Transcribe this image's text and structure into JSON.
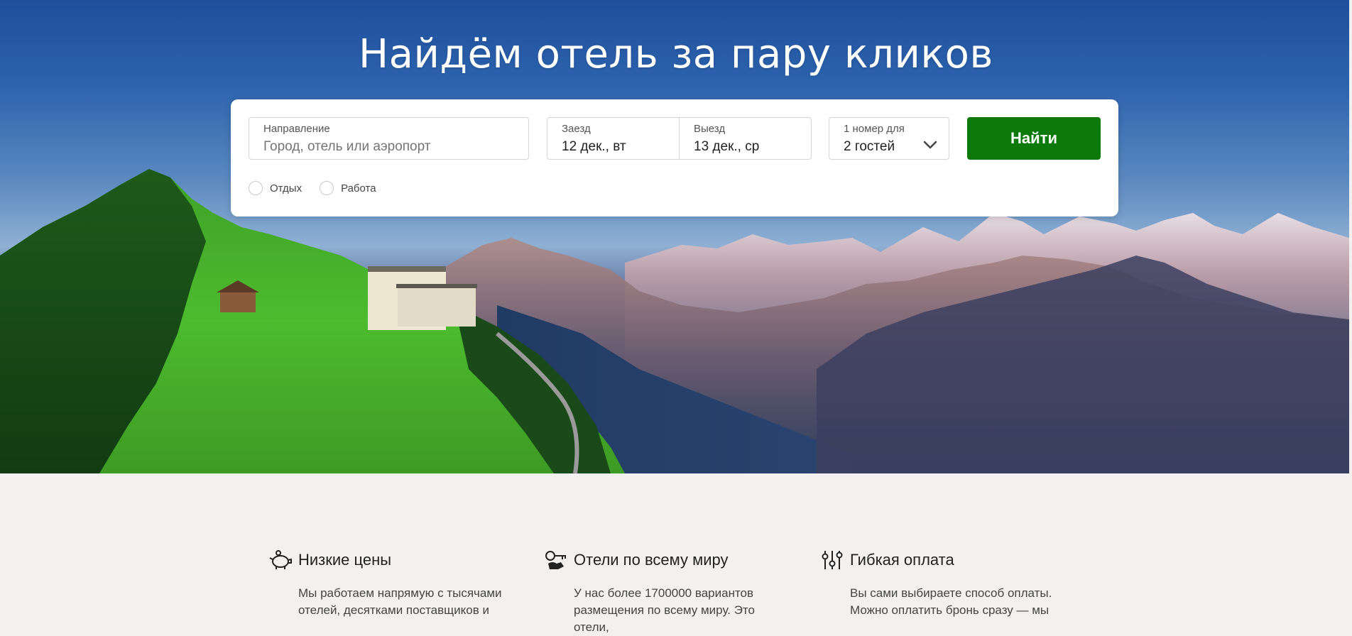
{
  "hero": {
    "title": "Найдём отель за пару кликов"
  },
  "search": {
    "destination_label": "Направление",
    "destination_placeholder": "Город, отель или аэропорт",
    "checkin_label": "Заезд",
    "checkin_value": "12 дек., вт",
    "checkout_label": "Выезд",
    "checkout_value": "13 дек., ср",
    "guests_label": "1 номер для",
    "guests_value": "2 гостей",
    "find_button": "Найти",
    "trip_type_options": [
      "Отдых",
      "Работа"
    ]
  },
  "features": [
    {
      "icon": "piggy-bank-icon",
      "title": "Низкие цены",
      "text_line1": "Мы работаем напрямую с тысячами",
      "text_line2": "отелей, десятками поставщиков и"
    },
    {
      "icon": "hotel-key-icon",
      "title": "Отели по всему миру",
      "text_line1": "У нас более 1700000 вариантов",
      "text_line2": "размещения по всему миру. Это отели,"
    },
    {
      "icon": "sliders-icon",
      "title": "Гибкая оплата",
      "text_line1": "Вы сами выбираете способ оплаты.",
      "text_line2": "Можно оплатить бронь сразу — мы"
    }
  ],
  "colors": {
    "accent_green": "#0b7a0b",
    "page_background": "#f2f1ef",
    "sky_blue": "#1f4f9c"
  }
}
